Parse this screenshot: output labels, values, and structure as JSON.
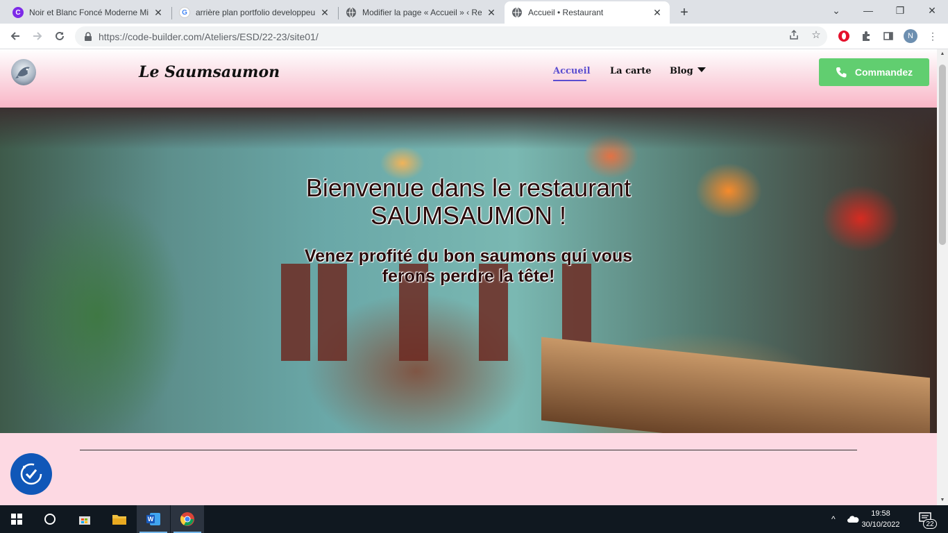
{
  "browser": {
    "tabs": [
      {
        "title": "Noir et Blanc Foncé Moderne Mi",
        "favicon": "canva-icon",
        "color": "#7d2ae8"
      },
      {
        "title": "arrière plan portfolio developpeu",
        "favicon": "google-icon",
        "color": "#4285f4"
      },
      {
        "title": "Modifier la page « Accueil » ‹ Res",
        "favicon": "globe-icon",
        "color": "#5f6368"
      },
      {
        "title": "Accueil • Restaurant",
        "favicon": "globe-icon",
        "color": "#5f6368",
        "active": true
      }
    ],
    "url": "https://code-builder.com/Ateliers/ESD/22-23/site01/",
    "profile_initial": "N"
  },
  "site": {
    "title": "Le Saumsaumon",
    "nav": [
      {
        "label": "Accueil",
        "active": true
      },
      {
        "label": "La carte"
      },
      {
        "label": "Blog",
        "has_dropdown": true
      }
    ],
    "order_button": "Commandez",
    "accent_color": "#5b4ed0",
    "button_color": "#61ce70",
    "background_color": "#fdd9e3"
  },
  "hero": {
    "heading_line1": "Bienvenue dans le restaurant",
    "heading_line2": "SAUMSAUMON !",
    "sub_line1": "Venez profité du bon saumons qui vous",
    "sub_line2": "ferons perdre la tête!"
  },
  "taskbar": {
    "time": "19:58",
    "date": "30/10/2022",
    "notifications": "22",
    "apps": [
      "windows-start-icon",
      "cortana-icon",
      "store-icon",
      "file-explorer-icon",
      "word-icon",
      "chrome-icon"
    ]
  }
}
